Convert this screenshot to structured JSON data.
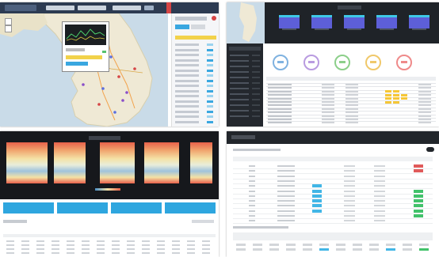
{
  "q1": {
    "title": "",
    "search_placeholder": "",
    "menu": [
      "",
      "",
      "",
      ""
    ],
    "popup_label": "",
    "side_rows": 16,
    "colors": {
      "header": "#2d3b52",
      "map_sea": "#c9dbe8",
      "land": "#efe9d5",
      "accent_red": "#d64545",
      "tag_yellow": "#f2d24a",
      "tag_blue": "#39a7e0"
    }
  },
  "q2": {
    "title": "",
    "cards": [
      "",
      "",
      "",
      "",
      ""
    ],
    "gauges": [
      "",
      "",
      "",
      "",
      ""
    ],
    "gauge_colors": [
      "#7fb2e0",
      "#b99be0",
      "#8ccf8a",
      "#f0c86a",
      "#ef8a8a"
    ],
    "table_rows": 12,
    "colors": {
      "dark": "#1f2328",
      "card": "#5d5fd8",
      "yellow": "#f6c737"
    }
  },
  "q3": {
    "title": "",
    "tabs": [
      "",
      "",
      "",
      ""
    ],
    "section_title": "",
    "table_rows": 4,
    "colors": {
      "dark": "#16181c",
      "tab": "#2ea6df",
      "heat_top": "#e7604a",
      "heat_mid": "#f4e2a6",
      "heat_low": "#4a90c8"
    }
  },
  "q4": {
    "title": "",
    "section1": "",
    "section2": "",
    "table_rows": 12,
    "colors": {
      "dark": "#22262b",
      "red": "#e05a5a",
      "green": "#41c26a",
      "blue": "#42b6e6"
    }
  }
}
